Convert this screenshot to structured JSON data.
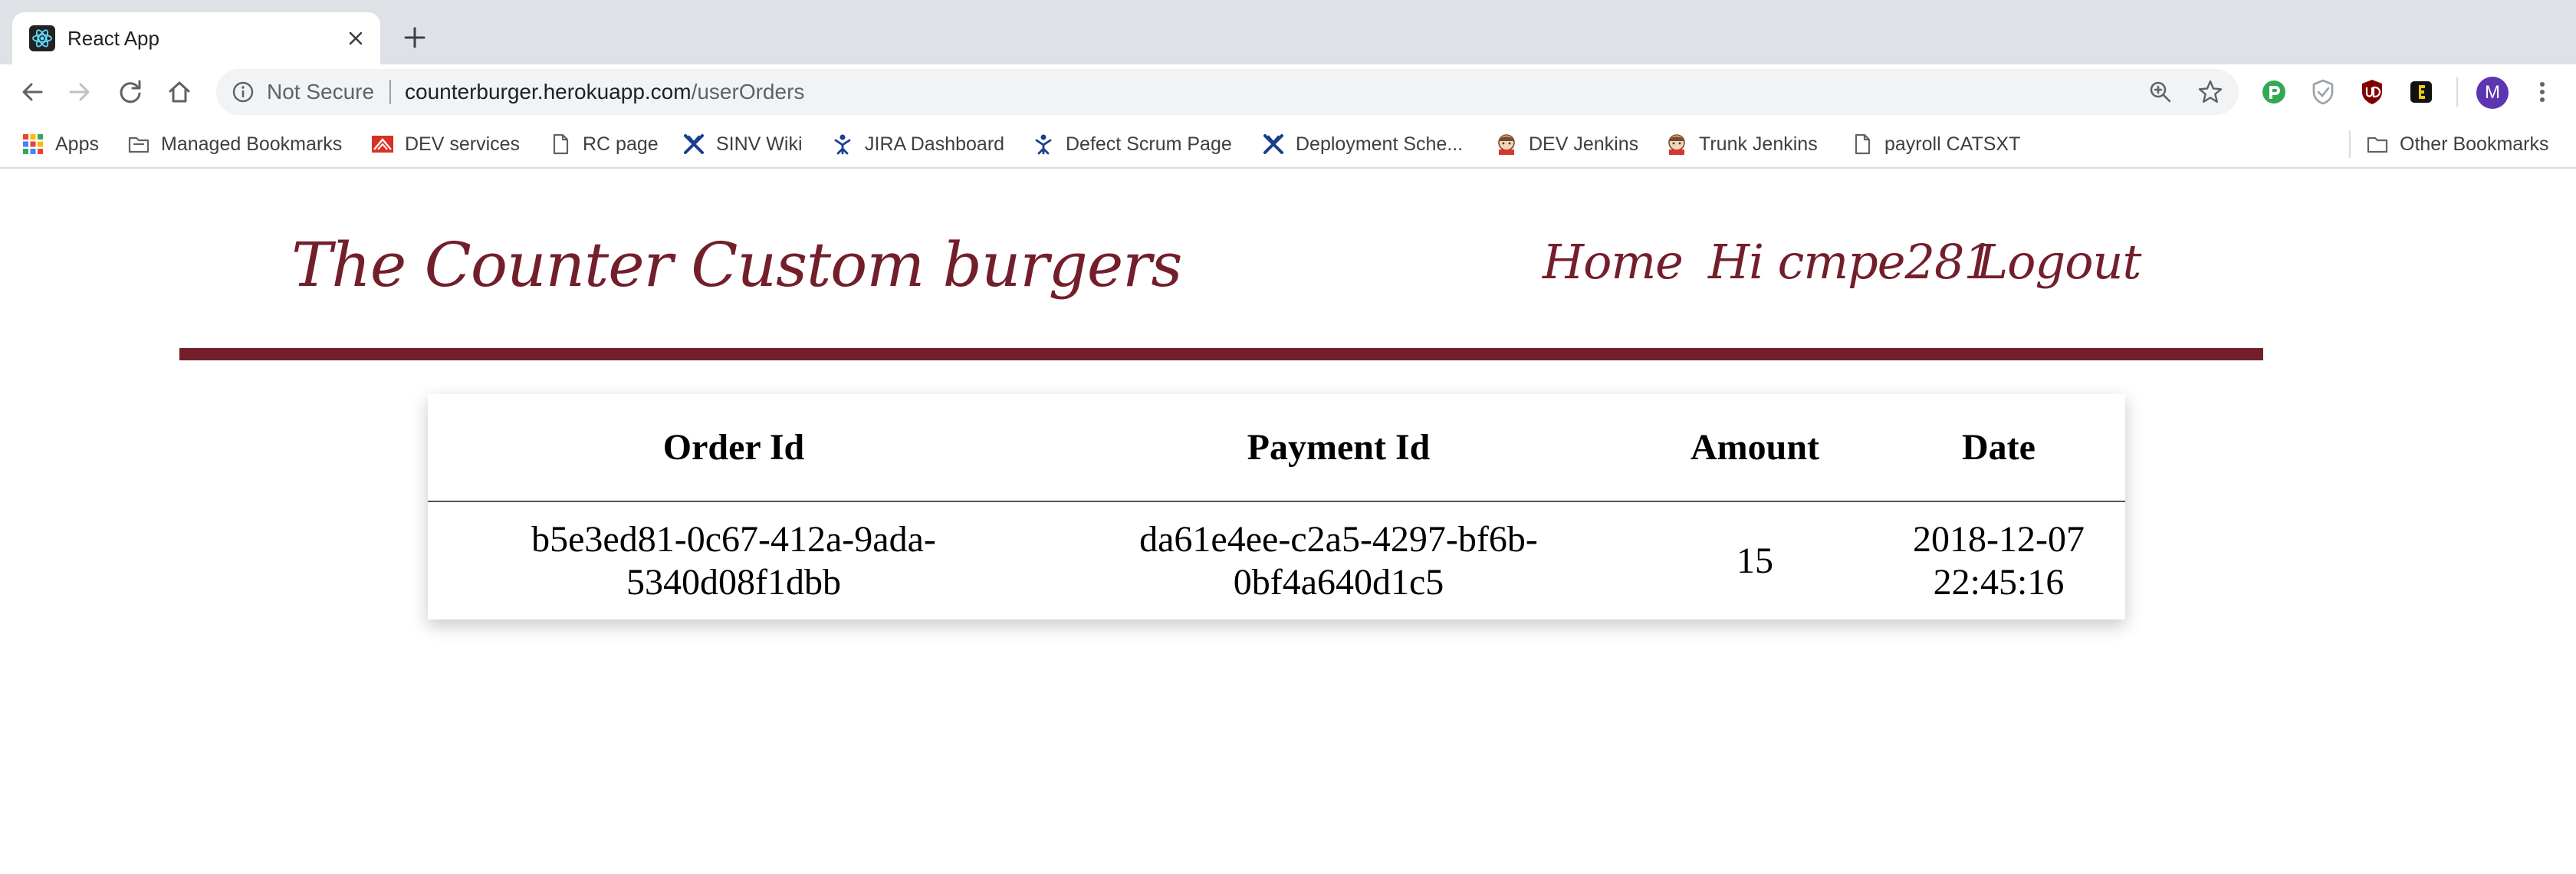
{
  "browser": {
    "tab_title": "React App",
    "security_label": "Not Secure",
    "url_host": "counterburger.herokuapp.com",
    "url_path": "/userOrders",
    "profile_initial": "M",
    "bookmarks": [
      {
        "label": "Apps",
        "icon": "apps-grid-icon"
      },
      {
        "label": "Managed Bookmarks",
        "icon": "folder-icon"
      },
      {
        "label": "DEV services",
        "icon": "red-mountain-icon"
      },
      {
        "label": "RC page",
        "icon": "page-icon"
      },
      {
        "label": "SINV Wiki",
        "icon": "x-logo-icon"
      },
      {
        "label": "JIRA Dashboard",
        "icon": "jira-icon"
      },
      {
        "label": "Defect Scrum Page",
        "icon": "jira-icon"
      },
      {
        "label": "Deployment Sche...",
        "icon": "x-logo-icon"
      },
      {
        "label": "DEV Jenkins",
        "icon": "jenkins-icon"
      },
      {
        "label": "Trunk Jenkins",
        "icon": "jenkins-icon"
      },
      {
        "label": "payroll CATSXT",
        "icon": "page-icon"
      }
    ],
    "other_bookmarks": "Other Bookmarks"
  },
  "header": {
    "brand": "The Counter Custom burgers",
    "nav": {
      "home": "Home",
      "greeting": "Hi cmpe281",
      "logout": "Logout"
    }
  },
  "orders": {
    "columns": [
      "Order Id",
      "Payment Id",
      "Amount",
      "Date"
    ],
    "rows": [
      {
        "order_id_line1": "b5e3ed81-0c67-412a-9ada-",
        "order_id_line2": "5340d08f1dbb",
        "payment_id_line1": "da61e4ee-c2a5-4297-bf6b-",
        "payment_id_line2": "0bf4a640d1c5",
        "amount": "15",
        "date_line1": "2018-12-07",
        "date_line2": "22:45:16"
      }
    ]
  },
  "colors": {
    "brand": "#731f2b",
    "tabstrip": "#dee1e6",
    "omnibox": "#f1f3f4"
  }
}
